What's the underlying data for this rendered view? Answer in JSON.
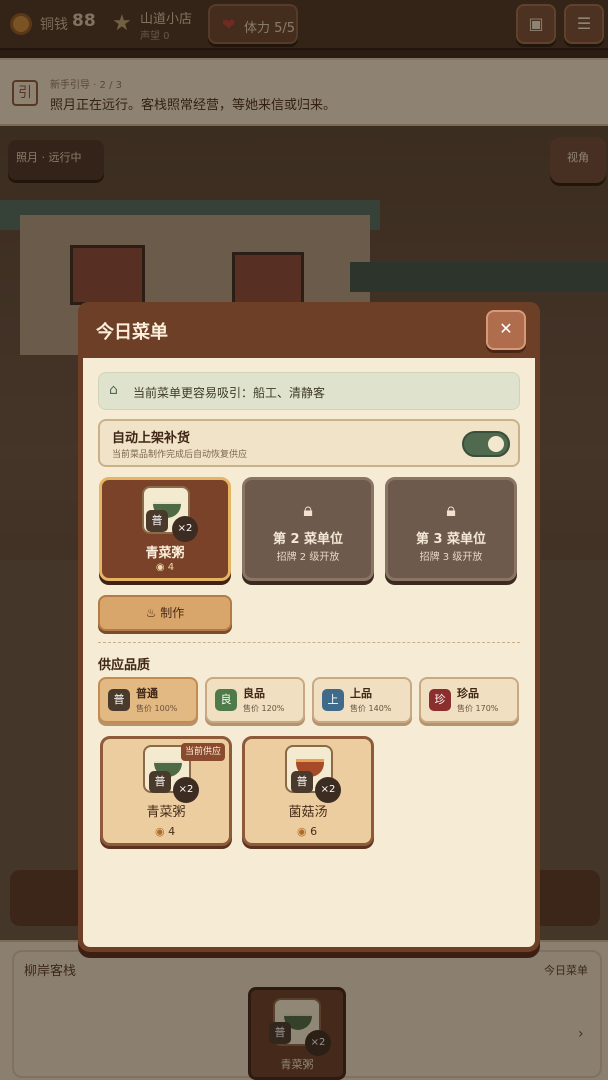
{
  "topbar": {
    "coin_label": "铜钱",
    "coin_value": "88",
    "shop_name": "山道小店",
    "reputation": "声望 0",
    "stamina": "体力 5/5",
    "save_icon": "save-icon",
    "settings_icon": "sliders-icon"
  },
  "guide": {
    "icon_char": "引",
    "step": "新手引导 · 2 / 3",
    "text": "照月正在远行。客栈照常经营，等她来信或归来。"
  },
  "scene": {
    "status": "照月 · 远行中",
    "view": "视角"
  },
  "modal": {
    "title": "今日菜单",
    "close": "✕",
    "attract_text": "当前菜单更容易吸引：船工、清静客",
    "auto_title": "自动上架补货",
    "auto_sub": "当前菜品制作完成后自动恢复供应",
    "auto_enabled": true,
    "slot1": {
      "name": "青菜粥",
      "price": "4",
      "grade": "普",
      "count": "×2"
    },
    "slot2": {
      "title": "第 2 菜单位",
      "sub": "招牌 2 级开放"
    },
    "slot3": {
      "title": "第 3 菜单位",
      "sub": "招牌 3 级开放"
    },
    "make_label": "制作",
    "quality_label": "供应品质",
    "qualities": [
      {
        "badge": "普",
        "name": "普通",
        "price": "售价 100%",
        "color": "#4a3a2c",
        "selected": true
      },
      {
        "badge": "良",
        "name": "良品",
        "price": "售价 120%",
        "color": "#4f7a4a",
        "selected": false
      },
      {
        "badge": "上",
        "name": "上品",
        "price": "售价 140%",
        "color": "#3f6a8a",
        "selected": false
      },
      {
        "badge": "珍",
        "name": "珍品",
        "price": "售价 170%",
        "color": "#8a2e2e",
        "selected": false
      }
    ],
    "menu_items": [
      {
        "name": "青菜粥",
        "price": "4",
        "grade": "普",
        "count": "×2",
        "badge": "当前供应"
      },
      {
        "name": "菌菇汤",
        "price": "6",
        "grade": "普",
        "count": "×2"
      }
    ]
  },
  "bottom": {
    "title": "柳岸客栈",
    "tag": "今日菜单",
    "card_name": "青菜粥",
    "card_grade": "普",
    "card_count": "×2"
  }
}
